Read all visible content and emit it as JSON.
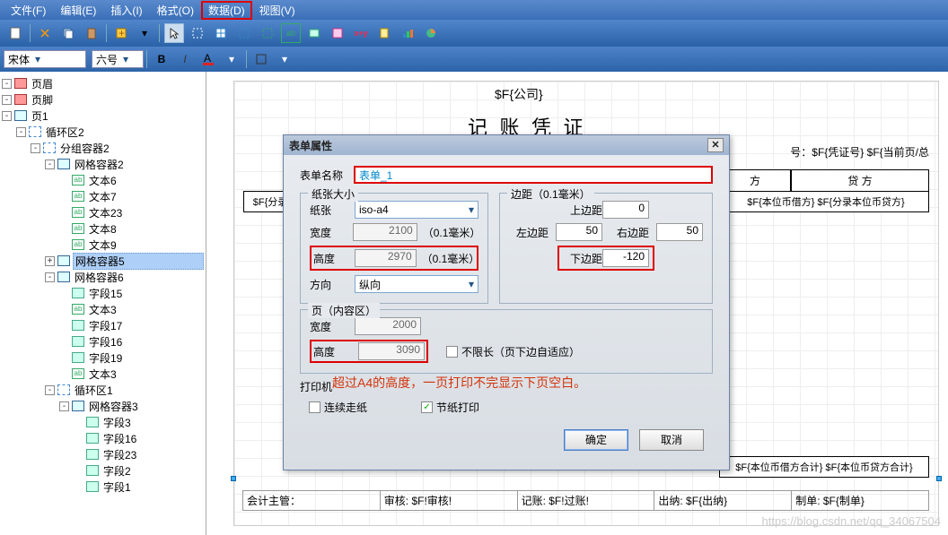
{
  "menu": [
    "文件(F)",
    "编辑(E)",
    "插入(I)",
    "格式(O)",
    "数据(D)",
    "视图(V)"
  ],
  "menu_hl_index": 4,
  "font_combo": "宋体",
  "size_combo": "六号",
  "tree": [
    {
      "d": 0,
      "exp": "-",
      "ico": "red",
      "t": "页眉"
    },
    {
      "d": 0,
      "exp": "-",
      "ico": "red",
      "t": "页脚"
    },
    {
      "d": 0,
      "exp": "-",
      "ico": "std",
      "t": "页1"
    },
    {
      "d": 1,
      "exp": "-",
      "ico": "dash",
      "t": "循环区2"
    },
    {
      "d": 2,
      "exp": "-",
      "ico": "dash",
      "t": "分组容器2"
    },
    {
      "d": 3,
      "exp": "-",
      "ico": "std",
      "t": "网格容器2"
    },
    {
      "d": 4,
      "exp": "",
      "ico": "ab",
      "t": "文本6"
    },
    {
      "d": 4,
      "exp": "",
      "ico": "ab",
      "t": "文本7"
    },
    {
      "d": 4,
      "exp": "",
      "ico": "ab",
      "t": "文本23"
    },
    {
      "d": 4,
      "exp": "",
      "ico": "ab",
      "t": "文本8"
    },
    {
      "d": 4,
      "exp": "",
      "ico": "ab",
      "t": "文本9"
    },
    {
      "d": 3,
      "exp": "+",
      "ico": "std",
      "t": "网格容器5",
      "sel": true
    },
    {
      "d": 3,
      "exp": "-",
      "ico": "std",
      "t": "网格容器6"
    },
    {
      "d": 4,
      "exp": "",
      "ico": "fld",
      "t": "字段15"
    },
    {
      "d": 4,
      "exp": "",
      "ico": "ab",
      "t": "文本3"
    },
    {
      "d": 4,
      "exp": "",
      "ico": "fld",
      "t": "字段17"
    },
    {
      "d": 4,
      "exp": "",
      "ico": "fld",
      "t": "字段16"
    },
    {
      "d": 4,
      "exp": "",
      "ico": "fld",
      "t": "字段19"
    },
    {
      "d": 4,
      "exp": "",
      "ico": "ab",
      "t": "文本3"
    },
    {
      "d": 3,
      "exp": "-",
      "ico": "dash",
      "t": "循环区1"
    },
    {
      "d": 4,
      "exp": "-",
      "ico": "std",
      "t": "网格容器3"
    },
    {
      "d": 5,
      "exp": "",
      "ico": "fld",
      "t": "字段3"
    },
    {
      "d": 5,
      "exp": "",
      "ico": "fld",
      "t": "字段16"
    },
    {
      "d": 5,
      "exp": "",
      "ico": "fld",
      "t": "字段23"
    },
    {
      "d": 5,
      "exp": "",
      "ico": "fld",
      "t": "字段2"
    },
    {
      "d": 5,
      "exp": "",
      "ico": "fld",
      "t": "字段1"
    }
  ],
  "doc": {
    "company": "$F{公司}",
    "title": "记 账 凭 证",
    "corner": "号：$F{凭证号}  $F{当前页/总",
    "h1": "方",
    "h2": "贷   方",
    "r2a": "$F{分录",
    "r2b": "$F{本位币借方} $F{分录本位币贷方}",
    "f1": "$F{本位币借方合计}  $F{本位币贷方合计}",
    "sig": [
      "会计主管：",
      "审核: $F!审核!",
      "记账: $F!过账!",
      "出纳: $F{出纳}",
      "制单: $F{制单}"
    ]
  },
  "dialog": {
    "title": "表单属性",
    "name_lbl": "表单名称",
    "name_val": "表单_1",
    "paper_legend": "纸张大小",
    "paper_lbl": "纸张",
    "paper_val": "iso-a4",
    "width_lbl": "宽度",
    "width_val": "2100",
    "unit": "（0.1毫米）",
    "height_lbl": "高度",
    "height_val": "2970",
    "dir_lbl": "方向",
    "dir_val": "纵向",
    "margin_legend": "边距（0.1毫米）",
    "m_top_lbl": "上边距",
    "m_top": "0",
    "m_left_lbl": "左边距",
    "m_left": "50",
    "m_right_lbl": "右边距",
    "m_right": "50",
    "m_bottom_lbl": "下边距",
    "m_bottom": "-120",
    "page_legend": "页（内容区）",
    "p_width_lbl": "宽度",
    "p_width": "2000",
    "p_height_lbl": "高度",
    "p_height": "3090",
    "nolimit_lbl": "不限长（页下边自适应）",
    "printer_lbl": "打印机",
    "cb1_lbl": "连续走纸",
    "cb2_lbl": "节纸打印",
    "ok": "确定",
    "cancel": "取消"
  },
  "annotation": "超过A4的高度，一页打印不完显示下页空白。",
  "watermark": "https://blog.csdn.net/qq_34067504"
}
